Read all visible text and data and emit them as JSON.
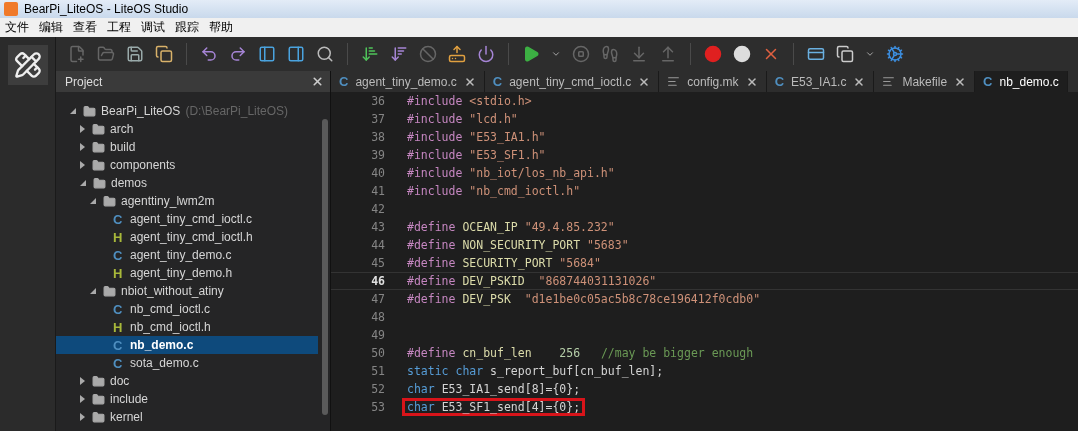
{
  "window": {
    "title": "BearPi_LiteOS - LiteOS Studio"
  },
  "menu": [
    "文件",
    "编辑",
    "查看",
    "工程",
    "调试",
    "跟踪",
    "帮助"
  ],
  "project": {
    "title": "Project",
    "tree": [
      {
        "name": "BearPi_LiteOS",
        "path": "(D:\\BearPi_LiteOS)",
        "kind": "folder",
        "expanded": true,
        "selected": false,
        "children": [
          {
            "name": "arch",
            "kind": "folder",
            "expanded": false,
            "selected": false
          },
          {
            "name": "build",
            "kind": "folder",
            "expanded": false,
            "selected": false
          },
          {
            "name": "components",
            "kind": "folder",
            "expanded": false,
            "selected": false
          },
          {
            "name": "demos",
            "kind": "folder",
            "expanded": true,
            "selected": false,
            "children": [
              {
                "name": "agenttiny_lwm2m",
                "kind": "folder",
                "expanded": true,
                "selected": false,
                "children": [
                  {
                    "name": "agent_tiny_cmd_ioctl.c",
                    "kind": "c",
                    "icon": "C",
                    "selected": false
                  },
                  {
                    "name": "agent_tiny_cmd_ioctl.h",
                    "kind": "h",
                    "icon": "H",
                    "selected": false
                  },
                  {
                    "name": "agent_tiny_demo.c",
                    "kind": "c",
                    "icon": "C",
                    "selected": false
                  },
                  {
                    "name": "agent_tiny_demo.h",
                    "kind": "h",
                    "icon": "H",
                    "selected": false
                  }
                ]
              },
              {
                "name": "nbiot_without_atiny",
                "kind": "folder",
                "expanded": true,
                "selected": false,
                "children": [
                  {
                    "name": "nb_cmd_ioctl.c",
                    "kind": "c",
                    "icon": "C",
                    "selected": false
                  },
                  {
                    "name": "nb_cmd_ioctl.h",
                    "kind": "h",
                    "icon": "H",
                    "selected": false
                  },
                  {
                    "name": "nb_demo.c",
                    "kind": "c",
                    "icon": "C",
                    "selected": true
                  },
                  {
                    "name": "sota_demo.c",
                    "kind": "c",
                    "icon": "C",
                    "selected": false
                  }
                ]
              }
            ]
          },
          {
            "name": "doc",
            "kind": "folder",
            "expanded": false,
            "selected": false
          },
          {
            "name": "include",
            "kind": "folder",
            "expanded": false,
            "selected": false
          },
          {
            "name": "kernel",
            "kind": "folder",
            "expanded": false,
            "selected": false
          }
        ]
      }
    ]
  },
  "tabs": [
    {
      "label": "agent_tiny_demo.c",
      "kind": "c",
      "icon": "C",
      "selected": false
    },
    {
      "label": "agent_tiny_cmd_ioctl.c",
      "kind": "c",
      "icon": "C",
      "selected": false
    },
    {
      "label": "config.mk",
      "kind": "text",
      "selected": false
    },
    {
      "label": "E53_IA1.c",
      "kind": "c",
      "icon": "C",
      "selected": false
    },
    {
      "label": "Makefile",
      "kind": "text",
      "selected": false
    },
    {
      "label": "nb_demo.c",
      "kind": "c",
      "icon": "C",
      "selected": true
    }
  ],
  "code": [
    {
      "number": "36",
      "current": false,
      "boxed": false,
      "tokens": [
        {
          "kind": "directive",
          "text": "#include"
        },
        {
          "kind": "string",
          "text": " <stdio.h>"
        }
      ]
    },
    {
      "number": "37",
      "current": false,
      "boxed": false,
      "tokens": [
        {
          "kind": "directive",
          "text": "#include"
        },
        {
          "kind": "string",
          "text": " \"lcd.h\""
        }
      ]
    },
    {
      "number": "38",
      "current": false,
      "boxed": false,
      "tokens": [
        {
          "kind": "directive",
          "text": "#include"
        },
        {
          "kind": "string",
          "text": " \"E53_IA1.h\""
        }
      ]
    },
    {
      "number": "39",
      "current": false,
      "boxed": false,
      "tokens": [
        {
          "kind": "directive",
          "text": "#include"
        },
        {
          "kind": "string",
          "text": " \"E53_SF1.h\""
        }
      ]
    },
    {
      "number": "40",
      "current": false,
      "boxed": false,
      "tokens": [
        {
          "kind": "directive",
          "text": "#include"
        },
        {
          "kind": "string",
          "text": " \"nb_iot/los_nb_api.h\""
        }
      ]
    },
    {
      "number": "41",
      "current": false,
      "boxed": false,
      "tokens": [
        {
          "kind": "directive",
          "text": "#include"
        },
        {
          "kind": "string",
          "text": " \"nb_cmd_ioctl.h\""
        }
      ]
    },
    {
      "number": "42",
      "current": false
    },
    {
      "number": "43",
      "current": false,
      "boxed": false,
      "tokens": [
        {
          "kind": "directive",
          "text": "#define"
        },
        {
          "kind": "macro",
          "text": " OCEAN_IP"
        },
        {
          "kind": "string",
          "text": " \"49.4.85.232\""
        }
      ]
    },
    {
      "number": "44",
      "current": false,
      "boxed": false,
      "tokens": [
        {
          "kind": "directive",
          "text": "#define"
        },
        {
          "kind": "macro",
          "text": " NON_SECURITY_PORT"
        },
        {
          "kind": "string",
          "text": " \"5683\""
        }
      ]
    },
    {
      "number": "45",
      "current": false,
      "boxed": false,
      "tokens": [
        {
          "kind": "directive",
          "text": "#define"
        },
        {
          "kind": "macro",
          "text": " SECURITY_PORT"
        },
        {
          "kind": "string",
          "text": " \"5684\""
        }
      ]
    },
    {
      "number": "46",
      "current": true,
      "boxed": false,
      "tokens": [
        {
          "kind": "directive",
          "text": "#define"
        },
        {
          "kind": "macro",
          "text": " DEV_PSKID"
        },
        {
          "kind": "string",
          "text": "  \"868744031131026\""
        }
      ]
    },
    {
      "number": "47",
      "current": false,
      "boxed": false,
      "tokens": [
        {
          "kind": "directive",
          "text": "#define"
        },
        {
          "kind": "macro",
          "text": " DEV_PSK"
        },
        {
          "kind": "string",
          "text": "  \"d1e1be0c05ac5b8c78ce196412f0cdb0\""
        }
      ]
    },
    {
      "number": "48",
      "current": false
    },
    {
      "number": "49",
      "current": false
    },
    {
      "number": "50",
      "current": false,
      "boxed": false,
      "tokens": [
        {
          "kind": "directive",
          "text": "#define"
        },
        {
          "kind": "macro",
          "text": " cn_buf_len"
        },
        {
          "kind": "number",
          "text": "    256"
        },
        {
          "kind": "comment",
          "text": "   //may be bigger enough"
        }
      ]
    },
    {
      "number": "51",
      "current": false,
      "boxed": false,
      "tokens": [
        {
          "kind": "keyword",
          "text": "static char"
        },
        {
          "kind": "plain",
          "text": " s_report_buf[cn_buf_len];"
        }
      ]
    },
    {
      "number": "52",
      "current": false,
      "boxed": false,
      "tokens": [
        {
          "kind": "keyword",
          "text": "char"
        },
        {
          "kind": "plain",
          "text": " E53_IA1_send[8]={0};"
        }
      ]
    },
    {
      "number": "53",
      "current": false,
      "boxed": true,
      "tokens": [
        {
          "kind": "keyword",
          "text": "char"
        },
        {
          "kind": "plain",
          "text": " E53_SF1_send[4]={0};"
        }
      ]
    }
  ]
}
